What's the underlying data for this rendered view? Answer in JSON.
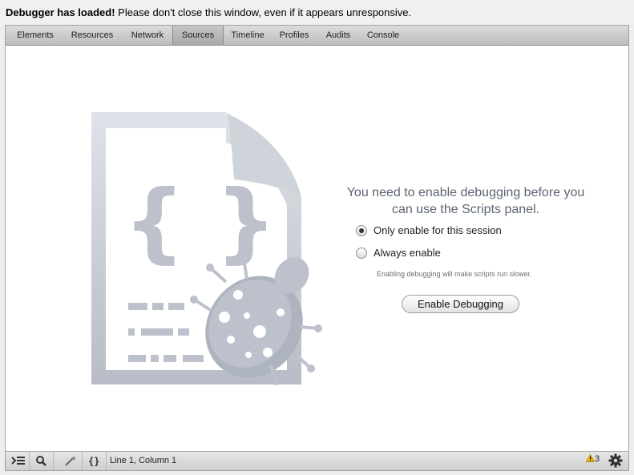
{
  "banner": {
    "bold": "Debugger has loaded!",
    "text": " Please don't close this window, even if it appears unresponsive."
  },
  "tabs": [
    {
      "label": "Elements",
      "selected": false
    },
    {
      "label": "Resources",
      "selected": false
    },
    {
      "label": "Network",
      "selected": false
    },
    {
      "label": "Sources",
      "selected": true
    },
    {
      "label": "Timeline",
      "selected": false
    },
    {
      "label": "Profiles",
      "selected": false
    },
    {
      "label": "Audits",
      "selected": false
    },
    {
      "label": "Console",
      "selected": false
    }
  ],
  "panel": {
    "message_line1": "You need to enable debugging before you",
    "message_line2": "can use the Scripts panel.",
    "option_session": "Only enable for this session",
    "option_always": "Always enable",
    "selected_option": "session",
    "note": "Enabling debugging will make scripts run slower.",
    "button": "Enable Debugging"
  },
  "statusbar": {
    "icons": [
      "console-drawer-icon",
      "search-icon",
      "wand-icon",
      "pretty-print-icon"
    ],
    "position": "Line 1, Column 1",
    "warnings": "3"
  },
  "colors": {
    "illustration": "#c4c9d2",
    "message": "#5b6472",
    "warning": "#f0b400"
  }
}
